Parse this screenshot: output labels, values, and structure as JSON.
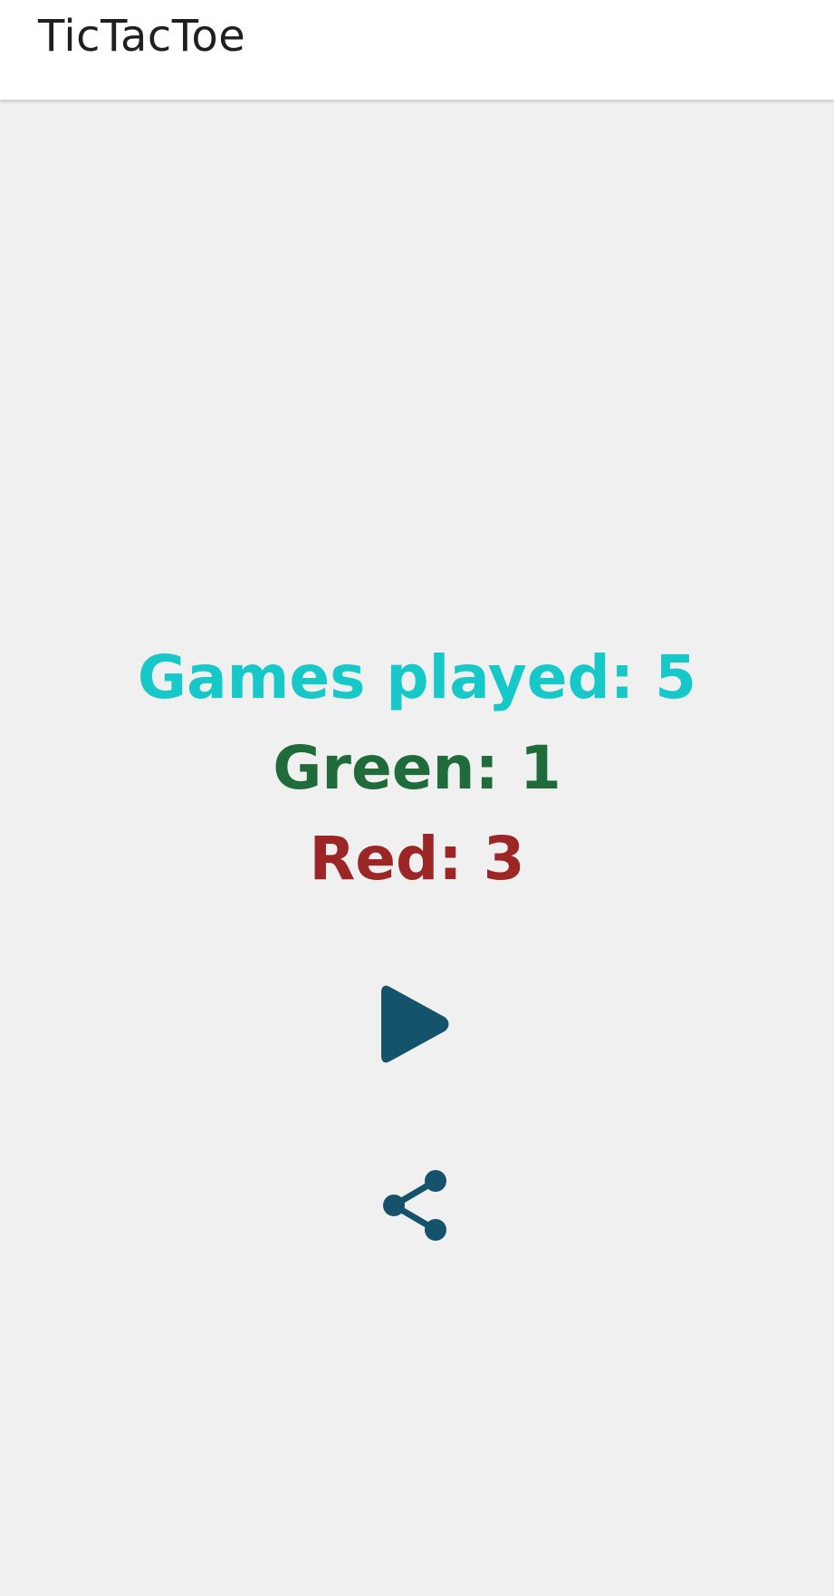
{
  "app_bar": {
    "title": "TicTacToe"
  },
  "stats": {
    "games_played": "Games played: 5",
    "green": "Green: 1",
    "red": "Red: 3"
  },
  "actions": {
    "play_icon": "play-icon",
    "share_icon": "share-icon"
  },
  "colors": {
    "background": "#f1f0f1",
    "app_bar": "#ffffff",
    "games_played": "#17c8c8",
    "green": "#1f6b3a",
    "red": "#9c2626",
    "icons": "#15526b"
  }
}
